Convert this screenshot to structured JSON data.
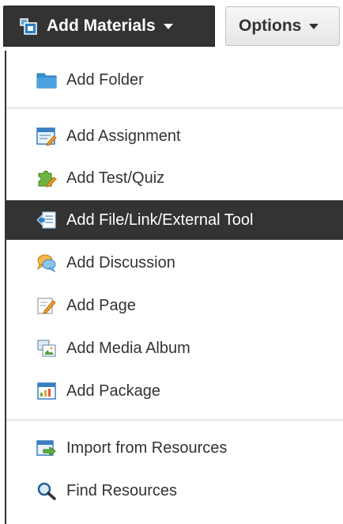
{
  "toolbar": {
    "add_materials_label": "Add Materials",
    "options_label": "Options"
  },
  "menu": {
    "items": [
      {
        "label": "Add Folder",
        "icon": "folder-icon"
      },
      {
        "label": "Add Assignment",
        "icon": "assignment-icon"
      },
      {
        "label": "Add Test/Quiz",
        "icon": "test-quiz-icon"
      },
      {
        "label": "Add File/Link/External Tool",
        "icon": "file-link-icon",
        "active": true
      },
      {
        "label": "Add Discussion",
        "icon": "discussion-icon"
      },
      {
        "label": "Add Page",
        "icon": "page-icon"
      },
      {
        "label": "Add Media Album",
        "icon": "media-album-icon"
      },
      {
        "label": "Add Package",
        "icon": "package-icon"
      },
      {
        "label": "Import from Resources",
        "icon": "import-icon"
      },
      {
        "label": "Find Resources",
        "icon": "find-search-icon"
      }
    ]
  },
  "colors": {
    "dark": "#333333",
    "active_text": "#ffffff",
    "text": "#333333",
    "divider": "#cfcfcf"
  }
}
